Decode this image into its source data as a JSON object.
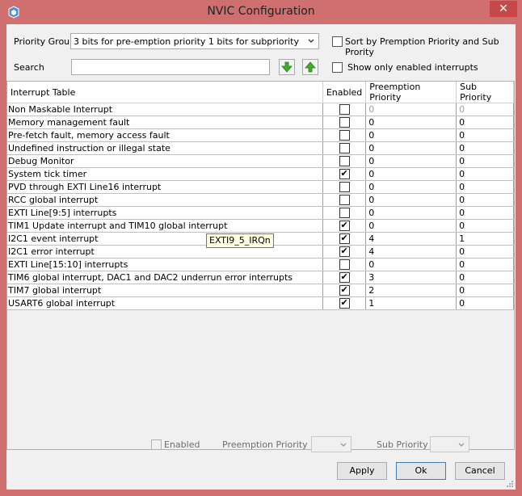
{
  "window": {
    "title": "NVIC Configuration",
    "app_icon": "app-icon",
    "close_glyph": "✕"
  },
  "top": {
    "priority_group_label": "Priority Group",
    "priority_group_value": "3 bits for pre-emption priority 1 bits for subpriority",
    "sort_label": "Sort by Premption Priority and Sub Prority",
    "sort_checked": false,
    "search_label": "Search",
    "search_value": "",
    "show_enabled_label": "Show only enabled interrupts",
    "show_enabled_checked": false
  },
  "table": {
    "headers": [
      "Interrupt Table",
      "Enabled",
      "Preemption Priority",
      "Sub Priority"
    ],
    "rows": [
      {
        "name": "Non Maskable Interrupt",
        "enabled": false,
        "preemption": "0",
        "sub": "0",
        "disabled": true
      },
      {
        "name": "Memory management fault",
        "enabled": false,
        "preemption": "0",
        "sub": "0",
        "disabled": false
      },
      {
        "name": "Pre-fetch fault, memory access fault",
        "enabled": false,
        "preemption": "0",
        "sub": "0",
        "disabled": false
      },
      {
        "name": "Undefined instruction or illegal state",
        "enabled": false,
        "preemption": "0",
        "sub": "0",
        "disabled": false
      },
      {
        "name": "Debug Monitor",
        "enabled": false,
        "preemption": "0",
        "sub": "0",
        "disabled": false
      },
      {
        "name": "System tick timer",
        "enabled": true,
        "preemption": "0",
        "sub": "0",
        "disabled": false
      },
      {
        "name": "PVD through EXTI Line16 interrupt",
        "enabled": false,
        "preemption": "0",
        "sub": "0",
        "disabled": false
      },
      {
        "name": "RCC global interrupt",
        "enabled": false,
        "preemption": "0",
        "sub": "0",
        "disabled": false
      },
      {
        "name": "EXTI Line[9:5] interrupts",
        "enabled": false,
        "preemption": "0",
        "sub": "0",
        "disabled": false
      },
      {
        "name": "TIM1 Update interrupt and TIM10 global interrupt",
        "enabled": true,
        "preemption": "0",
        "sub": "0",
        "disabled": false
      },
      {
        "name": "I2C1 event interrupt",
        "enabled": true,
        "preemption": "4",
        "sub": "1",
        "disabled": false
      },
      {
        "name": "I2C1 error interrupt",
        "enabled": true,
        "preemption": "4",
        "sub": "0",
        "disabled": false
      },
      {
        "name": "EXTI Line[15:10] interrupts",
        "enabled": false,
        "preemption": "0",
        "sub": "0",
        "disabled": false
      },
      {
        "name": "TIM6 global interrupt, DAC1 and DAC2 underrun error interrupts",
        "enabled": true,
        "preemption": "3",
        "sub": "0",
        "disabled": false
      },
      {
        "name": "TIM7 global interrupt",
        "enabled": true,
        "preemption": "2",
        "sub": "0",
        "disabled": false
      },
      {
        "name": "USART6 global interrupt",
        "enabled": true,
        "preemption": "1",
        "sub": "0",
        "disabled": false
      }
    ],
    "tooltip": "EXTI9_5_IRQn"
  },
  "bottom": {
    "enabled_label": "Enabled",
    "preemption_label": "Preemption Priority",
    "sub_label": "Sub Priority",
    "apply_label": "Apply",
    "ok_label": "Ok",
    "cancel_label": "Cancel"
  },
  "colors": {
    "frame": "#cf6f6f",
    "close": "#c74848",
    "arrow_green": "#3fae29"
  }
}
